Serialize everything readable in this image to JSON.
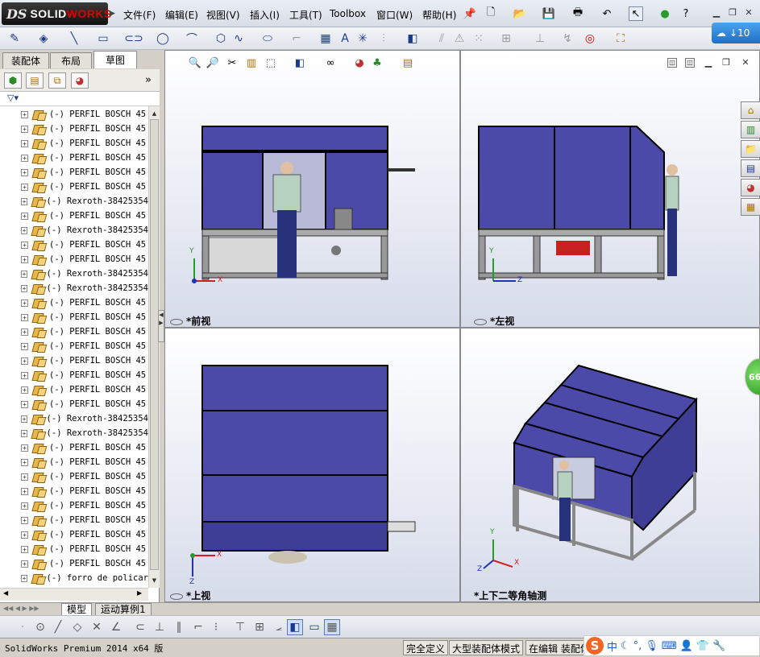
{
  "app": {
    "logo_ds": "DS",
    "logo_text_a": "SOLID",
    "logo_text_b": "WORKS"
  },
  "menu": [
    {
      "label": "文件(F)"
    },
    {
      "label": "编辑(E)"
    },
    {
      "label": "视图(V)"
    },
    {
      "label": "插入(I)"
    },
    {
      "label": "工具(T)"
    },
    {
      "label": "Toolbox"
    },
    {
      "label": "窗口(W)"
    },
    {
      "label": "帮助(H)"
    }
  ],
  "cloud_button": {
    "label": "10"
  },
  "panel_tabs": [
    {
      "label": "装配体"
    },
    {
      "label": "布局"
    },
    {
      "label": "草图"
    }
  ],
  "tree": {
    "prefix": "(-)",
    "items": [
      "PERFIL BOSCH 45",
      "PERFIL BOSCH 45",
      "PERFIL BOSCH 45",
      "PERFIL BOSCH 45",
      "PERFIL BOSCH 45",
      "PERFIL BOSCH 45",
      "Rexroth-38425354",
      "PERFIL BOSCH 45",
      "Rexroth-38425354",
      "PERFIL BOSCH 45",
      "PERFIL BOSCH 45",
      "Rexroth-38425354",
      "Rexroth-38425354",
      "PERFIL BOSCH 45",
      "PERFIL BOSCH 45",
      "PERFIL BOSCH 45",
      "PERFIL BOSCH 45",
      "PERFIL BOSCH 45",
      "PERFIL BOSCH 45",
      "PERFIL BOSCH 45",
      "PERFIL BOSCH 45",
      "Rexroth-38425354",
      "Rexroth-38425354",
      "PERFIL BOSCH 45",
      "PERFIL BOSCH 45",
      "PERFIL BOSCH 45",
      "PERFIL BOSCH 45",
      "PERFIL BOSCH 45",
      "PERFIL BOSCH 45",
      "PERFIL BOSCH 45",
      "PERFIL BOSCH 45",
      "PERFIL BOSCH 45",
      "forro de policar"
    ]
  },
  "viewports": {
    "front": {
      "label": "*前视",
      "axis_y": "Y",
      "axis_x": "X"
    },
    "left": {
      "label": "*左视",
      "axis_y": "Y",
      "axis_z": "Z"
    },
    "top": {
      "label": "*上视",
      "axis_x": "X",
      "axis_z": "Z"
    },
    "iso": {
      "label": "*上下二等角轴测",
      "axis_y": "Y",
      "axis_x": "X",
      "axis_z": "Z"
    }
  },
  "green_badge": {
    "label": "66"
  },
  "bottom_tabs": [
    {
      "label": "模型"
    },
    {
      "label": "运动算例1"
    }
  ],
  "status": {
    "product": "SolidWorks Premium 2014 x64 版",
    "fully_defined": "完全定义",
    "large_assembly": "大型装配体模式",
    "editing": "在编辑 装配体"
  },
  "ime": {
    "logo": "S",
    "lang": "中"
  },
  "colors": {
    "panel_blue": "#4b4aa8",
    "frame_gray": "#9a9a9a",
    "cloud_blue": "#1d6fc4",
    "ime_orange": "#f26522"
  }
}
